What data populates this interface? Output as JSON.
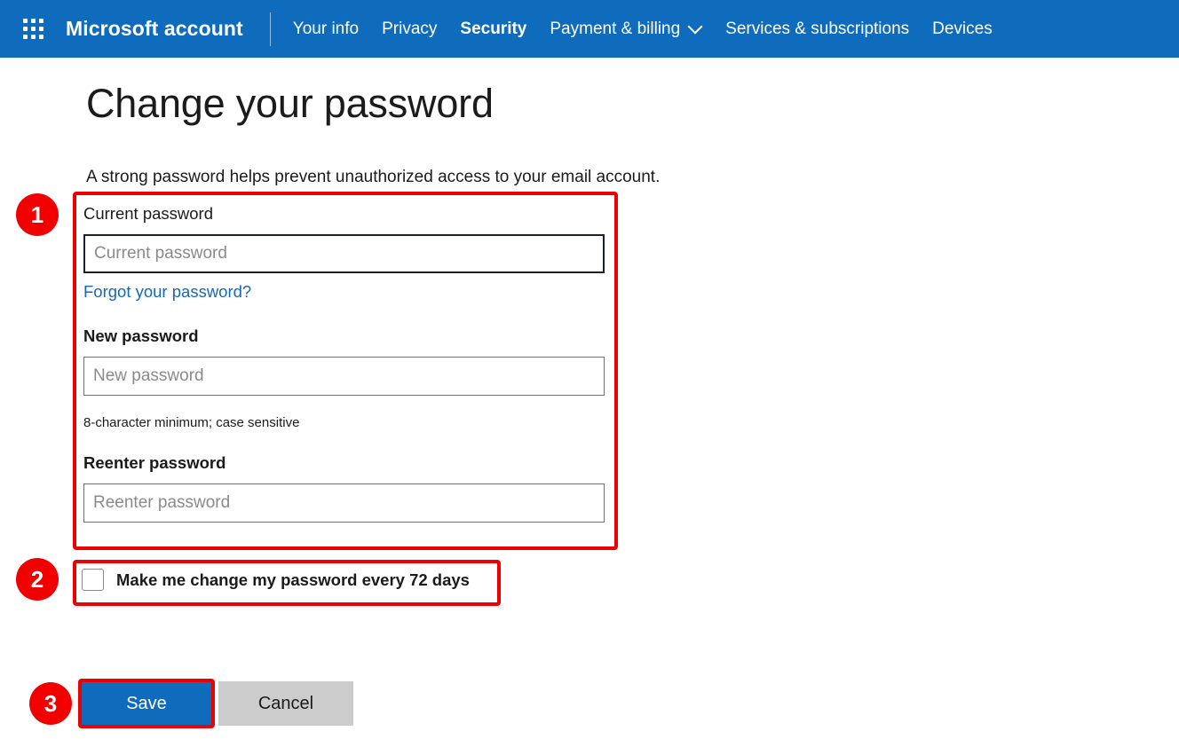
{
  "navbar": {
    "waffle_icon": "app-launcher-waffle-icon",
    "brand": "Microsoft account",
    "links": [
      {
        "label": "Your info",
        "active": false,
        "has_chevron": false
      },
      {
        "label": "Privacy",
        "active": false,
        "has_chevron": false
      },
      {
        "label": "Security",
        "active": true,
        "has_chevron": false
      },
      {
        "label": "Payment & billing",
        "active": false,
        "has_chevron": true
      },
      {
        "label": "Services & subscriptions",
        "active": false,
        "has_chevron": false
      },
      {
        "label": "Devices",
        "active": false,
        "has_chevron": false
      }
    ],
    "chevron_icon": "chevron-down-icon",
    "background_color": "#0f6cbd"
  },
  "page": {
    "title": "Change your password",
    "description": "A strong password helps prevent unauthorized access to your email account."
  },
  "form": {
    "current_password": {
      "label": "Current password",
      "placeholder": "Current password",
      "value": "",
      "focused": true
    },
    "forgot_link": "Forgot your password?",
    "new_password": {
      "label": "New password",
      "placeholder": "New password",
      "value": "",
      "focused": false
    },
    "new_password_hint": "8-character minimum; case sensitive",
    "reenter_password": {
      "label": "Reenter password",
      "placeholder": "Reenter password",
      "value": "",
      "focused": false
    }
  },
  "checkbox": {
    "label": "Make me change my password every 72 days",
    "checked": false
  },
  "buttons": {
    "save": "Save",
    "cancel": "Cancel",
    "save_color": "#0f6cbd",
    "cancel_color": "#cccccc"
  },
  "annotations": {
    "accent_color": "#ee0000",
    "badges": [
      {
        "number": "1"
      },
      {
        "number": "2"
      },
      {
        "number": "3"
      }
    ]
  }
}
